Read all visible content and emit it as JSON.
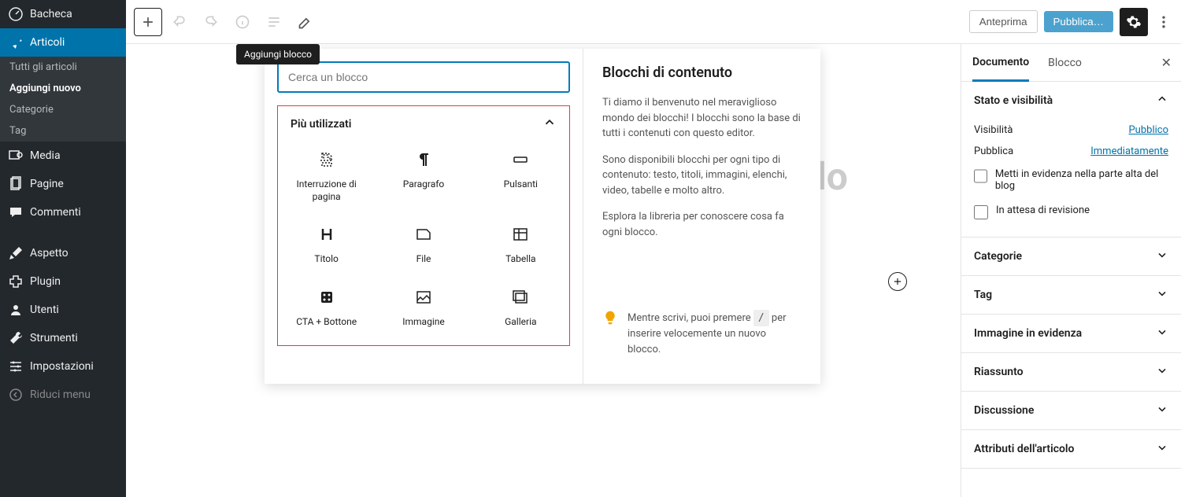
{
  "sidebar": {
    "items": [
      {
        "label": "Bacheca",
        "icon": "dashboard"
      },
      {
        "label": "Articoli",
        "icon": "pin",
        "active": true
      },
      {
        "label": "Media",
        "icon": "media"
      },
      {
        "label": "Pagine",
        "icon": "pages"
      },
      {
        "label": "Commenti",
        "icon": "comments"
      },
      {
        "label": "Aspetto",
        "icon": "brush"
      },
      {
        "label": "Plugin",
        "icon": "plugin"
      },
      {
        "label": "Utenti",
        "icon": "users"
      },
      {
        "label": "Strumenti",
        "icon": "tools"
      },
      {
        "label": "Impostazioni",
        "icon": "settings"
      },
      {
        "label": "Riduci menu",
        "icon": "collapse"
      }
    ],
    "sub": [
      {
        "label": "Tutti gli articoli"
      },
      {
        "label": "Aggiungi nuovo",
        "active": true
      },
      {
        "label": "Categorie"
      },
      {
        "label": "Tag"
      }
    ]
  },
  "toolbar": {
    "tooltip": "Aggiungi blocco",
    "preview": "Anteprima",
    "publish": "Pubblica…"
  },
  "canvas": {
    "title_placeholder": "olo"
  },
  "inserter": {
    "search_placeholder": "Cerca un blocco",
    "section_title": "Più utilizzati",
    "blocks": [
      {
        "label": "Interruzione di pagina",
        "icon": "pagebreak"
      },
      {
        "label": "Paragrafo",
        "icon": "paragraph"
      },
      {
        "label": "Pulsanti",
        "icon": "buttons"
      },
      {
        "label": "Titolo",
        "icon": "heading"
      },
      {
        "label": "File",
        "icon": "file"
      },
      {
        "label": "Tabella",
        "icon": "table"
      },
      {
        "label": "CTA + Bottone",
        "icon": "cta"
      },
      {
        "label": "Immagine",
        "icon": "image"
      },
      {
        "label": "Galleria",
        "icon": "gallery"
      }
    ],
    "right": {
      "title": "Blocchi di contenuto",
      "p1": "Ti diamo il benvenuto nel meraviglioso mondo dei blocchi! I blocchi sono la base di tutti i contenuti con questo editor.",
      "p2": "Sono disponibili blocchi per ogni tipo di contenuto: testo, titoli, immagini, elenchi, video, tabelle e molto altro.",
      "p3": "Esplora la libreria per conoscere cosa fa ogni blocco.",
      "tip_before": "Mentre scrivi, puoi premere ",
      "tip_key": "/",
      "tip_after": " per inserire velocemente un nuovo blocco."
    }
  },
  "right_panel": {
    "tabs": {
      "doc": "Documento",
      "block": "Blocco"
    },
    "status": {
      "title": "Stato e visibilità",
      "visibility_label": "Visibilità",
      "visibility_value": "Pubblico",
      "publish_label": "Pubblica",
      "publish_value": "Immediatamente",
      "sticky": "Metti in evidenza nella parte alta del blog",
      "pending": "In attesa di revisione"
    },
    "sections": [
      "Categorie",
      "Tag",
      "Immagine in evidenza",
      "Riassunto",
      "Discussione",
      "Attributi dell'articolo"
    ]
  }
}
